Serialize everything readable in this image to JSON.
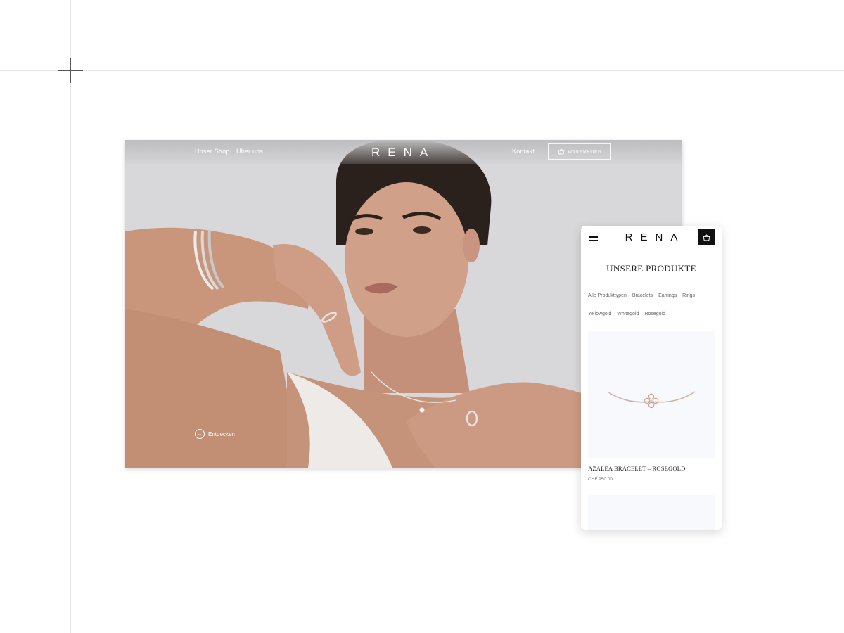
{
  "desktop": {
    "nav": {
      "shop": "Unser Shop",
      "about": "Über uns",
      "contact": "Kontakt",
      "cart": "WARENKORB"
    },
    "logo": "RENA",
    "hero": {
      "discover": "Entdecken",
      "image_alt": "Model wearing RENA bracelets, rings, earrings and necklace"
    }
  },
  "mobile": {
    "logo": "RENA",
    "title": "UNSERE PRODUKTE",
    "filters_row1": [
      "Alle Produkttypen",
      "Bracelets",
      "Earrings",
      "Rings"
    ],
    "filters_row2": [
      "Yellowgold",
      "Whitegold",
      "Rosegold"
    ],
    "product": {
      "name": "AZALEA BRACELET – ROSEGOLD",
      "price": "CHF 950.00"
    }
  }
}
